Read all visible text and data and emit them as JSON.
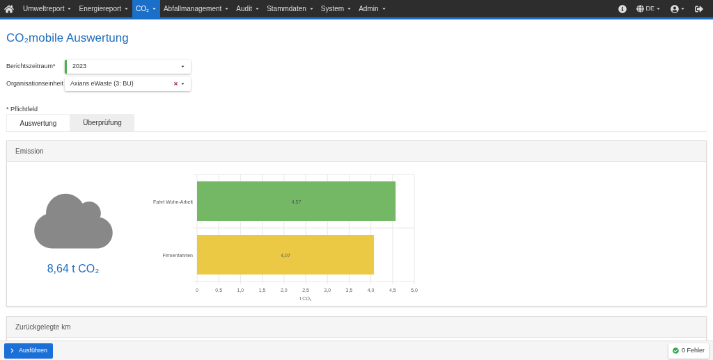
{
  "nav": {
    "items": [
      {
        "label": "Umweltreport",
        "selected": false
      },
      {
        "label": "Energiereport",
        "selected": false
      },
      {
        "label": "CO₂",
        "selected": true
      },
      {
        "label": "Abfallmanagement",
        "selected": false
      },
      {
        "label": "Audit",
        "selected": false
      },
      {
        "label": "Stammdaten",
        "selected": false
      },
      {
        "label": "System",
        "selected": false
      },
      {
        "label": "Admin",
        "selected": false
      }
    ],
    "language": "DE"
  },
  "title": "CO₂mobile Auswertung",
  "form": [
    {
      "label": "Berichtszeitraum*",
      "value": "2023",
      "required": true,
      "clearable": false
    },
    {
      "label": "Organisationseinheit",
      "value": "Axians eWaste (3: BU)",
      "required": false,
      "clearable": true
    }
  ],
  "required_note": "* Pflichtfeld",
  "tabs": [
    {
      "label": "Auswertung",
      "selected": true
    },
    {
      "label": "Überprüfung",
      "selected": false
    }
  ],
  "panels": [
    {
      "title": "Emission",
      "total": "8,64 t CO₂",
      "chart_data": {
        "type": "bar",
        "orientation": "horizontal",
        "xlabel": "t CO₂",
        "categories": [
          "Fahrt Wohn-Arbeit",
          "Firmenfahrten"
        ],
        "grid": true,
        "series": [
          {
            "colors": [
              "#74b866",
              "#ebc944"
            ],
            "values": [
              4.57,
              4.07
            ]
          }
        ],
        "value_labels": [
          "4,57",
          "4,07"
        ],
        "xlim": [
          0,
          5
        ],
        "xticks": [
          {
            "value": 0,
            "label": "0"
          },
          {
            "value": 0.5,
            "label": "0,5"
          },
          {
            "value": 1,
            "label": "1,0"
          },
          {
            "value": 1.5,
            "label": "1,5"
          },
          {
            "value": 2,
            "label": "2,0"
          },
          {
            "value": 2.5,
            "label": "2,5"
          },
          {
            "value": 3,
            "label": "3,0"
          },
          {
            "value": 3.5,
            "label": "3,5"
          },
          {
            "value": 4,
            "label": "4,0"
          },
          {
            "value": 4.5,
            "label": "4,5"
          },
          {
            "value": 5,
            "label": "5,0"
          }
        ]
      }
    },
    {
      "title": "Zurückgelegte km"
    }
  ],
  "footer": {
    "run_button": "Ausführen",
    "errors": "0 Fehler"
  }
}
